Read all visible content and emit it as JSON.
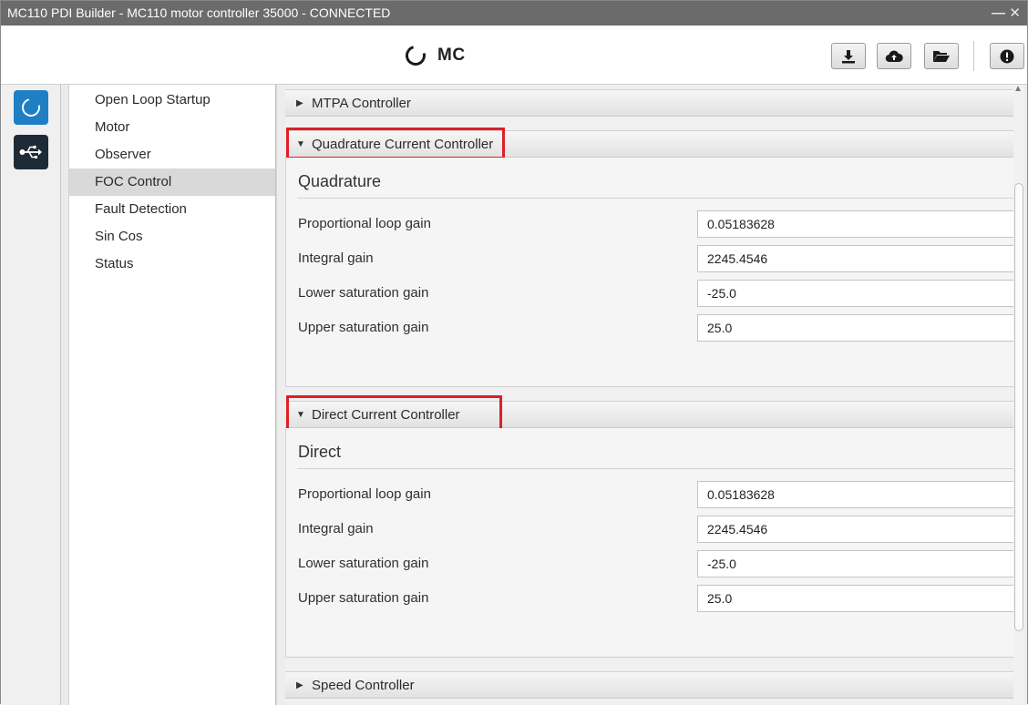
{
  "window": {
    "title": "MC110 PDI Builder - MC110 motor controller 35000 - CONNECTED",
    "minimize": "—",
    "close": "✕"
  },
  "header": {
    "app_name": "MC",
    "tools": [
      {
        "icon": "download-icon"
      },
      {
        "icon": "cloud-upload-icon"
      },
      {
        "icon": "folder-open-icon"
      },
      {
        "icon": "info-icon"
      }
    ]
  },
  "iconstrip": [
    {
      "icon": "motor-controller-icon"
    },
    {
      "icon": "usb-icon"
    }
  ],
  "nav": {
    "items": [
      "Open Loop Startup",
      "Motor",
      "Observer",
      "FOC Control",
      "Fault Detection",
      "Sin Cos",
      "Status"
    ],
    "active": "FOC Control"
  },
  "sections": {
    "mtpa": {
      "label": "MTPA Controller",
      "expanded": false
    },
    "quadrature": {
      "label": "Quadrature Current Controller",
      "expanded": true,
      "group_title": "Quadrature",
      "fields": [
        {
          "label": "Proportional loop gain",
          "value": "0.05183628"
        },
        {
          "label": "Integral gain",
          "value": "2245.4546"
        },
        {
          "label": "Lower saturation gain",
          "value": "-25.0"
        },
        {
          "label": "Upper saturation gain",
          "value": "25.0"
        }
      ]
    },
    "direct": {
      "label": "Direct Current Controller",
      "expanded": true,
      "group_title": "Direct",
      "fields": [
        {
          "label": "Proportional loop gain",
          "value": "0.05183628"
        },
        {
          "label": "Integral gain",
          "value": "2245.4546"
        },
        {
          "label": "Lower saturation gain",
          "value": "-25.0"
        },
        {
          "label": "Upper saturation gain",
          "value": "25.0"
        }
      ]
    },
    "speed": {
      "label": "Speed Controller",
      "expanded": false
    }
  },
  "colors": {
    "highlight_box": "#e01e26",
    "accent_blue": "#1f7fc4",
    "titlebar": "#6b6b6b"
  }
}
